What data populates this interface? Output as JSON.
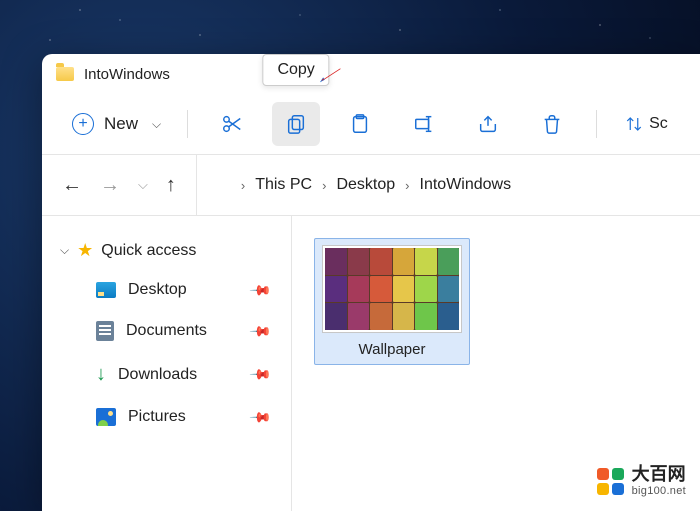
{
  "window": {
    "title": "IntoWindows"
  },
  "toolbar": {
    "new_label": "New",
    "tooltip_copy": "Copy",
    "sort_label": "Sc"
  },
  "breadcrumbs": {
    "items": [
      "This PC",
      "Desktop",
      "IntoWindows"
    ]
  },
  "sidebar": {
    "quick_access_label": "Quick access",
    "items": [
      {
        "label": "Desktop"
      },
      {
        "label": "Documents"
      },
      {
        "label": "Downloads"
      },
      {
        "label": "Pictures"
      }
    ]
  },
  "content": {
    "files": [
      {
        "label": "Wallpaper"
      }
    ]
  },
  "watermark": {
    "brand": "大百网",
    "domain": "big100.net"
  },
  "colors": {
    "accent": "#1a6fd6",
    "selection_bg": "#dbe9fb",
    "selection_border": "#8ab4e8"
  }
}
